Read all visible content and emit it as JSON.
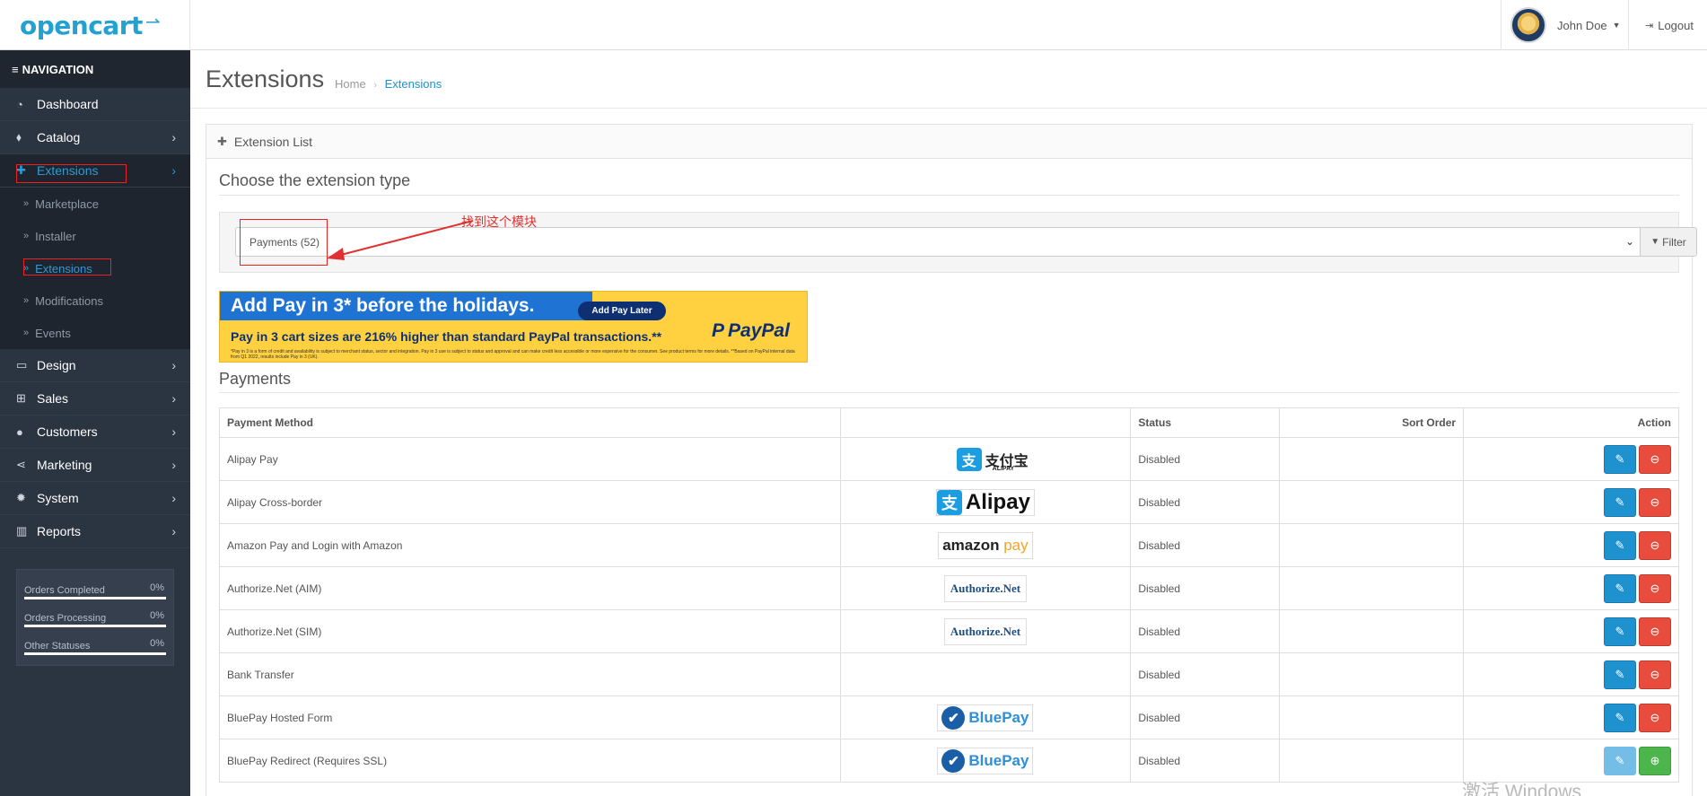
{
  "header": {
    "logo_text": "opencart",
    "logo_cart": "🛒",
    "user_name": "John Doe",
    "logout_label": "Logout"
  },
  "sidebar": {
    "title": "NAVIGATION",
    "items": [
      {
        "label": "Dashboard",
        "icon": "dashboard-icon"
      },
      {
        "label": "Catalog",
        "icon": "tags-icon"
      },
      {
        "label": "Extensions",
        "icon": "puzzle-icon"
      },
      {
        "label": "Design",
        "icon": "monitor-icon"
      },
      {
        "label": "Sales",
        "icon": "cart-icon"
      },
      {
        "label": "Customers",
        "icon": "user-icon"
      },
      {
        "label": "Marketing",
        "icon": "share-icon"
      },
      {
        "label": "System",
        "icon": "gear-icon"
      },
      {
        "label": "Reports",
        "icon": "bar-chart-icon"
      }
    ],
    "sub_items": [
      "Marketplace",
      "Installer",
      "Extensions",
      "Modifications",
      "Events"
    ],
    "stats": [
      {
        "label": "Orders Completed",
        "value": "0%"
      },
      {
        "label": "Orders Processing",
        "value": "0%"
      },
      {
        "label": "Other Statuses",
        "value": "0%"
      }
    ]
  },
  "page": {
    "title": "Extensions",
    "breadcrumb": [
      "Home",
      "Extensions"
    ],
    "panel_title": "Extension List",
    "choose_type": "Choose the extension type",
    "select_value": "Payments (52)",
    "filter_label": "Filter",
    "annotation": "找到这个模块",
    "section_title": "Payments"
  },
  "banner": {
    "title": "Add Pay in 3* before the holidays.",
    "cta": "Add Pay Later",
    "subtitle": "Pay in 3 cart sizes are 216% higher than standard PayPal transactions.**",
    "logo": "PayPal",
    "fine_print": "*Pay in 3 is a form of credit and availability is subject to merchant status, sector and integration. Pay in 3 use is subject to status and approval and can make credit less accessible or more expensive for the consumer. See product terms for more details. **Based on PayPal internal data from Q1 2022, results include Pay in 3 (UK)."
  },
  "table": {
    "headers": [
      "Payment Method",
      "",
      "Status",
      "Sort Order",
      "Action"
    ],
    "rows": [
      {
        "method": "Alipay Pay",
        "logo": "支付宝",
        "logo_sub": "ALIPAY",
        "status": "Disabled",
        "sort": "",
        "installed": true
      },
      {
        "method": "Alipay Cross-border",
        "logo": "Alipay",
        "status": "Disabled",
        "sort": "",
        "installed": true
      },
      {
        "method": "Amazon Pay and Login with Amazon",
        "logo": "amazon",
        "logo_sub": "pay",
        "status": "Disabled",
        "sort": "",
        "installed": true
      },
      {
        "method": "Authorize.Net (AIM)",
        "logo": "Authorize.Net",
        "status": "Disabled",
        "sort": "",
        "installed": true
      },
      {
        "method": "Authorize.Net (SIM)",
        "logo": "Authorize.Net",
        "status": "Disabled",
        "sort": "",
        "installed": true
      },
      {
        "method": "Bank Transfer",
        "logo": "",
        "status": "Disabled",
        "sort": "",
        "installed": true
      },
      {
        "method": "BluePay Hosted Form",
        "logo": "BluePay",
        "status": "Disabled",
        "sort": "",
        "installed": true
      },
      {
        "method": "BluePay Redirect (Requires SSL)",
        "logo": "BluePay",
        "status": "Disabled",
        "sort": "",
        "installed": false
      }
    ]
  },
  "watermark": "激活 Windows",
  "colors": {
    "sidebar_bg": "#2b3441",
    "accent": "#1e91cf",
    "danger": "#e74c3c",
    "success": "#4cb64c",
    "annotation": "#e03030"
  }
}
